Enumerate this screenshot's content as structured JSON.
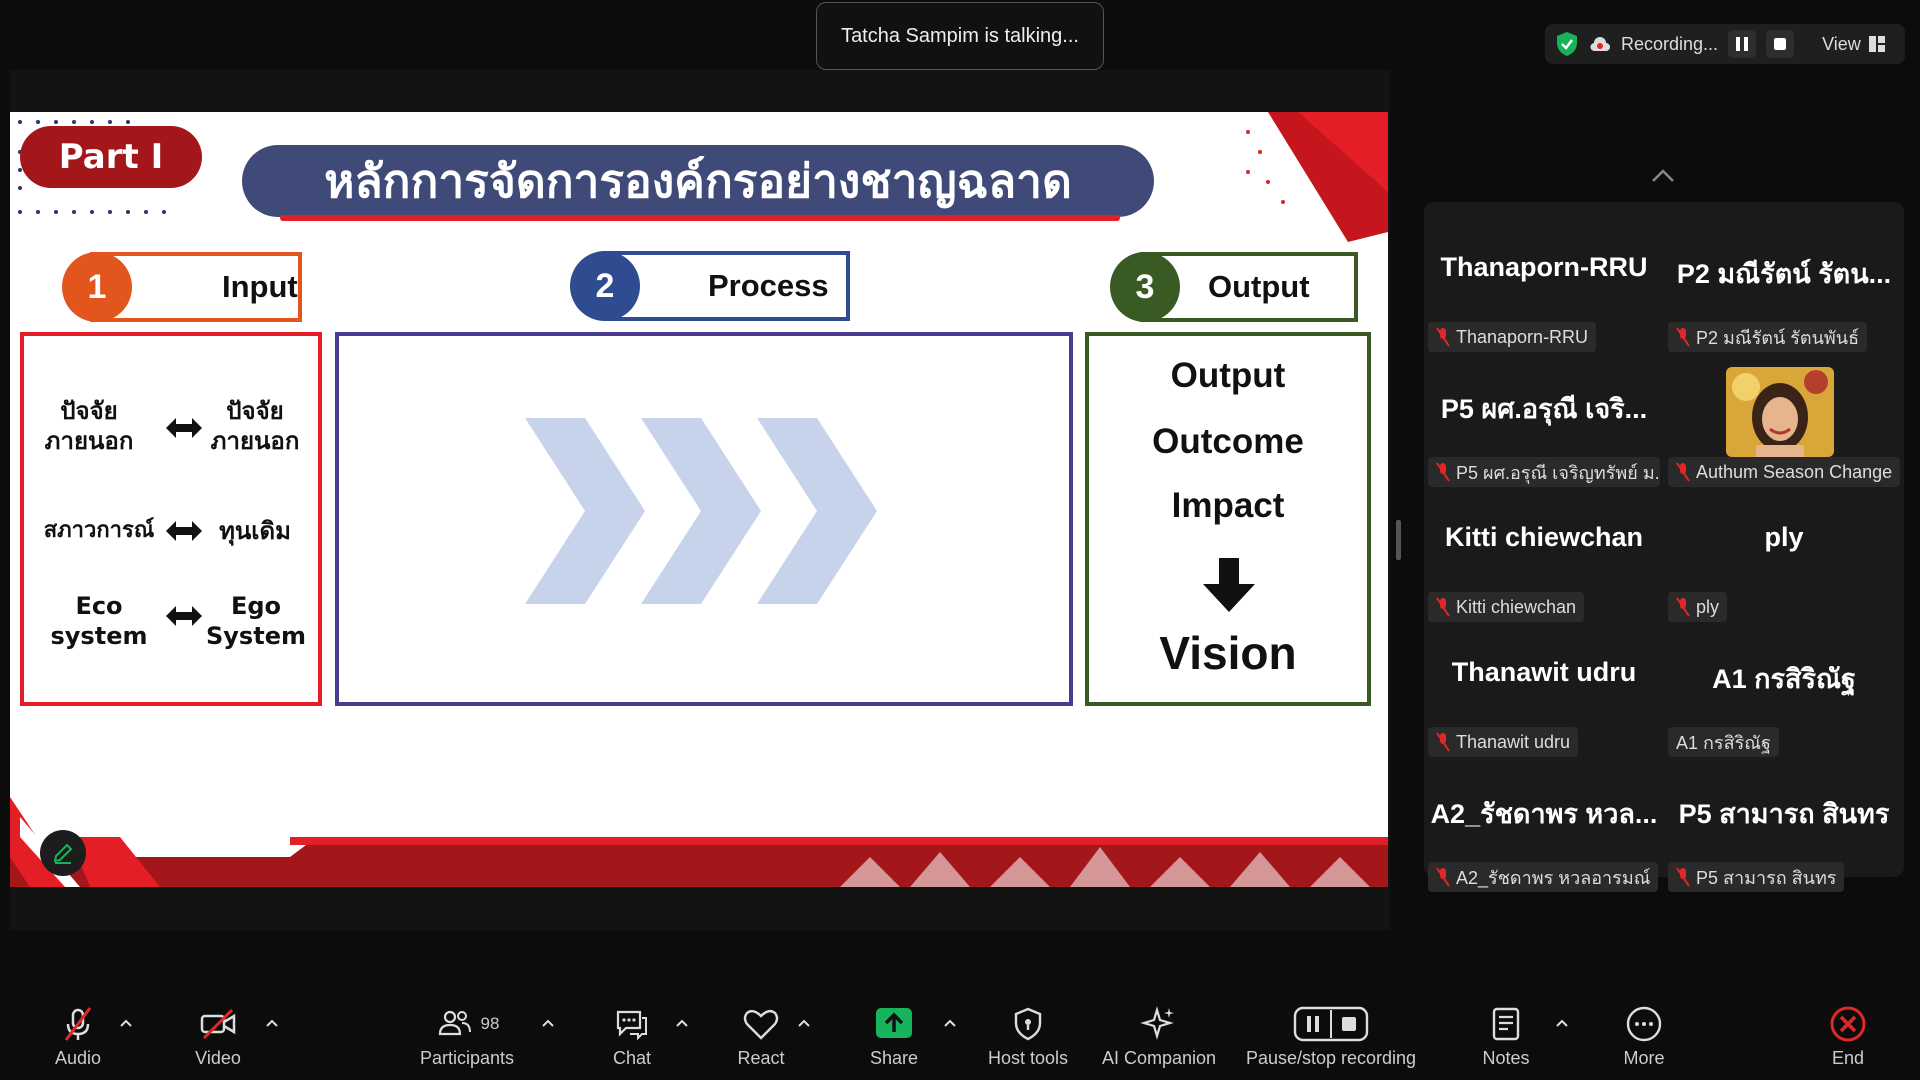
{
  "top": {
    "talking": "Tatcha Sampim is talking...",
    "recording_label": "Recording...",
    "view_label": "View"
  },
  "slide": {
    "part": "Part I",
    "title": "หลักการจัดการองค์กรอย่างชาญฉลาด",
    "input": {
      "number": "1",
      "label": "Input",
      "rows": [
        {
          "left": "ปัจจัย\nภายนอก",
          "right": "ปัจจัย\nภายนอก"
        },
        {
          "left": "สภาวการณ์",
          "right": "ทุนเดิม"
        },
        {
          "left": "Eco\nsystem",
          "right": "Ego\nSystem"
        }
      ]
    },
    "process": {
      "number": "2",
      "label": "Process"
    },
    "output": {
      "number": "3",
      "label": "Output",
      "items": [
        "Output",
        "Outcome",
        "Impact"
      ],
      "final": "Vision"
    }
  },
  "gallery": {
    "tiles": [
      {
        "name": "Thanaporn-RRU",
        "label": "Thanaporn-RRU",
        "muted": true
      },
      {
        "name": "P2 มณีรัตน์ รัตน...",
        "label": "P2 มณีรัตน์ รัตนพันธ์",
        "muted": true
      },
      {
        "name": "P5 ผศ.อรุณี เจริ...",
        "label": "P5 ผศ.อรุณี เจริญทรัพย์ ม...",
        "muted": true
      },
      {
        "name": "",
        "label": "Authum Season Change",
        "muted": true,
        "avatar": true
      },
      {
        "name": "Kitti chiewchan",
        "label": "Kitti chiewchan",
        "muted": true
      },
      {
        "name": "ply",
        "label": "ply",
        "muted": true
      },
      {
        "name": "Thanawit udru",
        "label": "Thanawit udru",
        "muted": true
      },
      {
        "name": "A1 กรสิริณัฐ",
        "label": "A1 กรสิริณัฐ",
        "muted": false
      },
      {
        "name": "A2_รัชดาพร หวล...",
        "label": "A2_รัชดาพร หวลอารมณ์",
        "muted": true
      },
      {
        "name": "P5 สามารถ สินทร",
        "label": "P5 สามารถ สินทร",
        "muted": true
      }
    ]
  },
  "toolbar": {
    "audio": "Audio",
    "video": "Video",
    "participants": "Participants",
    "participants_count": "98",
    "chat": "Chat",
    "react": "React",
    "share": "Share",
    "host_tools": "Host tools",
    "ai": "AI Companion",
    "pause_rec": "Pause/stop recording",
    "notes": "Notes",
    "more": "More",
    "end": "End"
  },
  "colors": {
    "accent_red": "#e41e26",
    "dark_red": "#a3171b",
    "navy": "#404a78",
    "blue": "#2e4c8f",
    "green": "#3a5a23",
    "orange": "#e2561e",
    "share_green": "#18b45c",
    "end_red": "#e02828"
  }
}
